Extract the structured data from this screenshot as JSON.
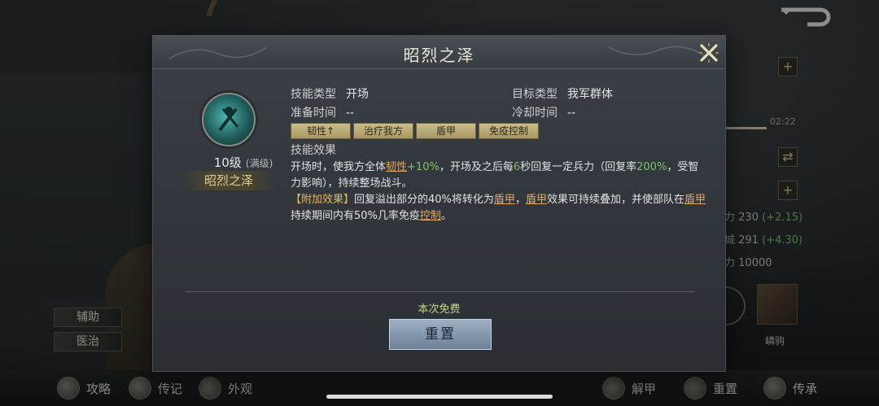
{
  "background": {
    "right_time": "02:22",
    "stats": [
      {
        "label": "力",
        "value": "230",
        "bonus": "(+2.15)"
      },
      {
        "label": "城",
        "value": "291",
        "bonus": "(+4.30)"
      },
      {
        "label": "力",
        "value": "10000",
        "bonus": ""
      }
    ],
    "portrait_name": "嶙驹",
    "side_tabs": [
      "辅助",
      "医治"
    ],
    "bottom_left": [
      "攻略",
      "传记",
      "外观"
    ],
    "bottom_right": [
      "解甲",
      "重置",
      "传承"
    ]
  },
  "dialog": {
    "title": "昭烈之泽",
    "level": "10级",
    "level_max": "(满级)",
    "skill_name": "昭烈之泽",
    "skill_type_label": "技能类型",
    "skill_type_value": "开场",
    "target_label": "目标类型",
    "target_value": "我军群体",
    "prep_label": "准备时间",
    "prep_value": "--",
    "cooldown_label": "冷却时间",
    "cooldown_value": "--",
    "tags": [
      "韧性↑",
      "治疗我方",
      "盾甲",
      "免疫控制"
    ],
    "effect_title": "技能效果",
    "effect": {
      "p1_a": "开场时，使我方全体",
      "p1_kw1": "韧性",
      "p1_num1": "+10%",
      "p1_b": "，开场及之后每",
      "p1_num2": "6",
      "p1_c": "秒回复一定兵力（回复率",
      "p1_num3": "200%",
      "p1_d": "，受智力影响），持续整场战斗。",
      "p2_extra": "【附加效果】",
      "p2_a": "回复溢出部分的40%将转化为",
      "p2_kw1": "盾甲",
      "p2_b": "，",
      "p2_kw2": "盾甲",
      "p2_c": "效果可持续叠加，并使部队在",
      "p2_kw3": "盾甲",
      "p2_d": "持续期间内有50%几率免疫",
      "p2_kw4": "控制",
      "p2_e": "。"
    },
    "free_label": "本次免费",
    "reset_label": "重置"
  }
}
